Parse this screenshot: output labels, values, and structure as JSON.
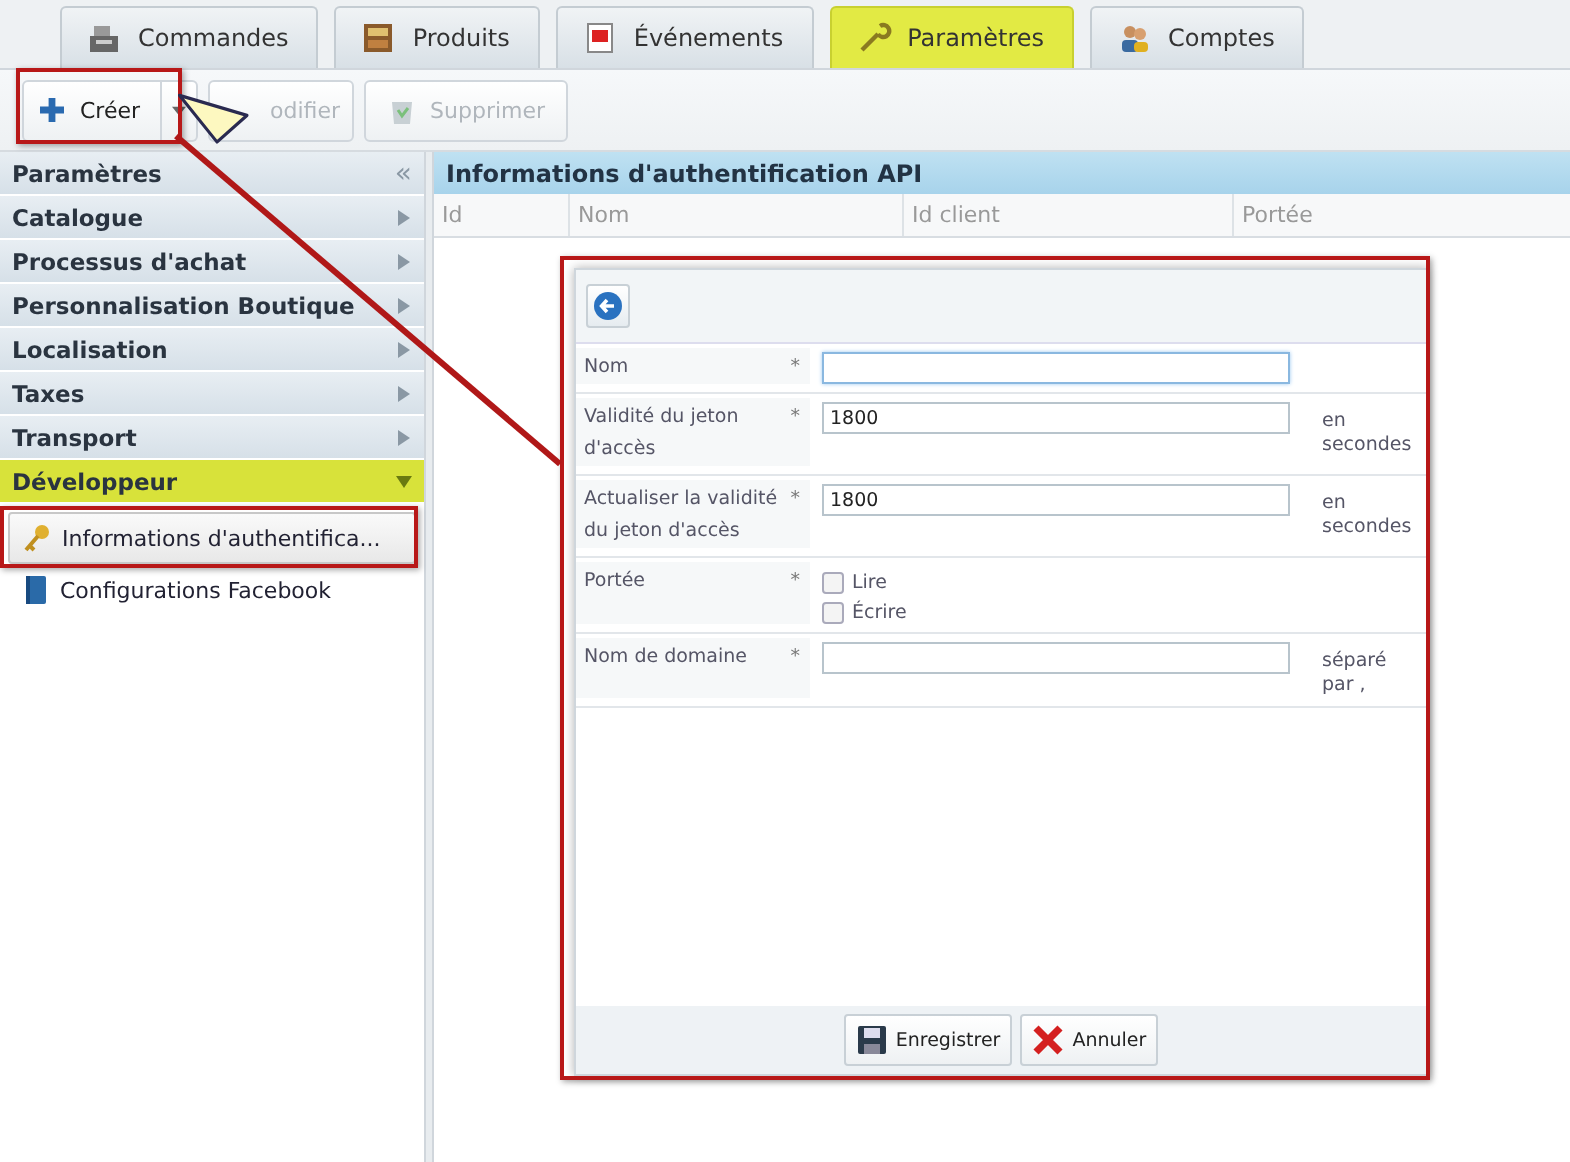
{
  "tabs": [
    {
      "label": "Commandes",
      "selected": false
    },
    {
      "label": "Produits",
      "selected": false
    },
    {
      "label": "Événements",
      "selected": false
    },
    {
      "label": "Paramètres",
      "selected": true
    },
    {
      "label": "Comptes",
      "selected": false
    }
  ],
  "toolbar": [
    {
      "label": "Créer",
      "kind": "create",
      "disabled": false
    },
    {
      "label": "odifier",
      "kind": "edit",
      "disabled": true
    },
    {
      "label": "Supprimer",
      "kind": "delete",
      "disabled": true
    }
  ],
  "sidebar": {
    "title": "Paramètres",
    "collapse_glyph": "«",
    "sections": [
      {
        "label": "Catalogue",
        "expanded": false
      },
      {
        "label": "Processus d'achat",
        "expanded": false
      },
      {
        "label": "Personnalisation Boutique",
        "expanded": false
      },
      {
        "label": "Localisation",
        "expanded": false
      },
      {
        "label": "Taxes",
        "expanded": false
      },
      {
        "label": "Transport",
        "expanded": false
      },
      {
        "label": "Développeur",
        "expanded": true,
        "children": [
          {
            "label": "Informations d'authentifica...",
            "selected": true
          },
          {
            "label": "Configurations Facebook",
            "selected": false
          }
        ]
      }
    ]
  },
  "panel": {
    "title": "Informations d'authentification API",
    "columns": [
      "Id",
      "Nom",
      "Id client",
      "Portée"
    ]
  },
  "form": {
    "fields": [
      {
        "kind": "text",
        "label": "Nom",
        "required": "*",
        "focused": true
      },
      {
        "kind": "text",
        "label": "Validité du jeton d'accès",
        "required": "*",
        "value": "1800",
        "unit": "en secondes",
        "focused": false
      },
      {
        "kind": "text",
        "label": "Actualiser la validité du jeton d'accès",
        "required": "*",
        "value": "1800",
        "unit": "en secondes",
        "focused": false
      },
      {
        "kind": "checkboxes",
        "label": "Portée",
        "required": "*",
        "options": [
          {
            "label": "Lire",
            "checked": false
          },
          {
            "label": "Écrire",
            "checked": false
          }
        ]
      },
      {
        "kind": "text",
        "label": "Nom de domaine",
        "required": "*",
        "unit": "séparé par ,",
        "focused": false
      }
    ],
    "buttons": [
      {
        "label": "Enregistrer",
        "kind": "save"
      },
      {
        "label": "Annuler",
        "kind": "cancel"
      }
    ]
  }
}
